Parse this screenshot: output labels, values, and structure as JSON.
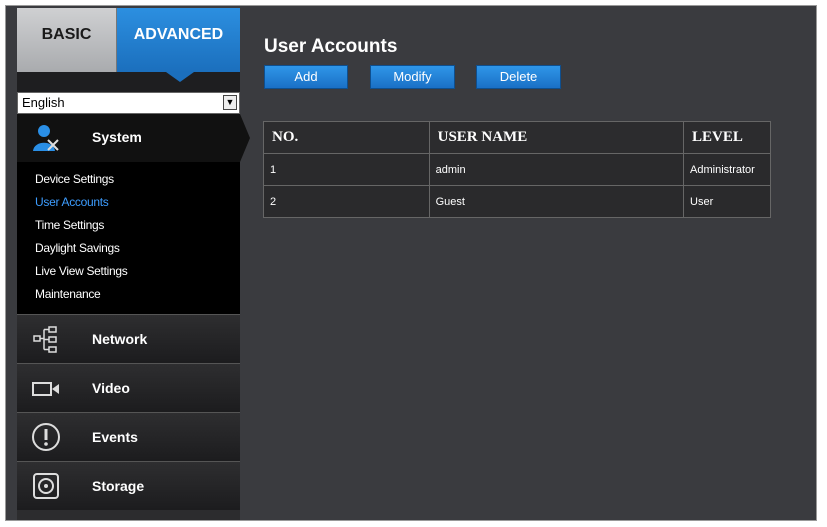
{
  "tabs": {
    "basic": "BASIC",
    "advanced": "ADVANCED"
  },
  "language": {
    "selected": "English"
  },
  "sidebar": {
    "system": {
      "label": "System",
      "items": [
        "Device Settings",
        "User Accounts",
        "Time Settings",
        "Daylight Savings",
        "Live View Settings",
        "Maintenance"
      ]
    },
    "sections": [
      {
        "label": "Network",
        "icon": "network-icon"
      },
      {
        "label": "Video",
        "icon": "video-camera-icon"
      },
      {
        "label": "Events",
        "icon": "exclamation-icon"
      },
      {
        "label": "Storage",
        "icon": "storage-disk-icon"
      }
    ]
  },
  "main": {
    "title": "User Accounts",
    "buttons": {
      "add": "Add",
      "modify": "Modify",
      "delete": "Delete"
    },
    "table": {
      "headers": [
        "NO.",
        "USER NAME",
        "LEVEL"
      ],
      "rows": [
        [
          "1",
          "admin",
          "Administrator"
        ],
        [
          "2",
          "Guest",
          "User"
        ]
      ]
    }
  },
  "colors": {
    "accent": "#1b6fbd",
    "active_link": "#3d9dff",
    "background": "#3a3b3f"
  }
}
